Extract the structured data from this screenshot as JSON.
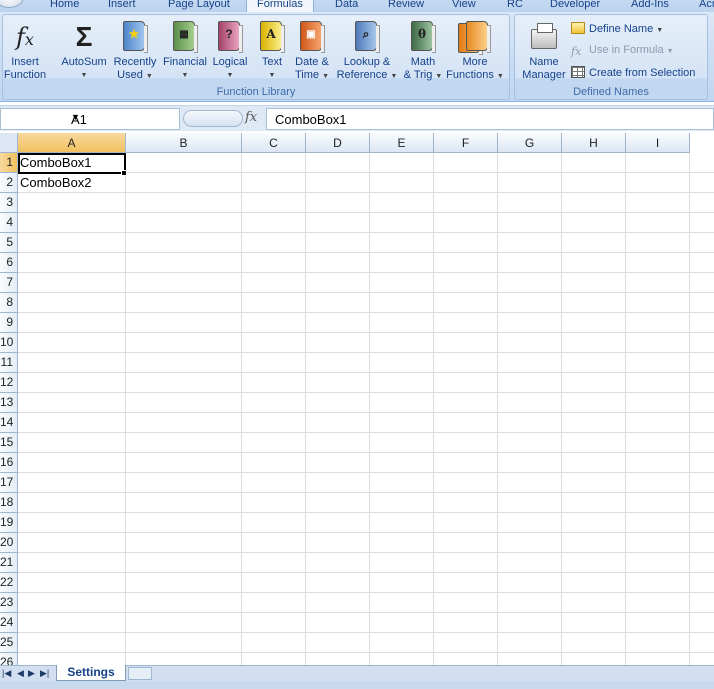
{
  "tabs": [
    "Home",
    "Insert",
    "Page Layout",
    "Formulas",
    "Data",
    "Review",
    "View",
    "RC",
    "Developer",
    "Add-Ins",
    "Acr"
  ],
  "active_tab": "Formulas",
  "function_library": {
    "group_label": "Function Library",
    "insert_function": [
      "Insert",
      "Function"
    ],
    "autosum": "AutoSum",
    "recently_used": [
      "Recently",
      "Used"
    ],
    "financial": "Financial",
    "logical": "Logical",
    "text": "Text",
    "date_time": [
      "Date &",
      "Time"
    ],
    "lookup": [
      "Lookup &",
      "Reference"
    ],
    "math": [
      "Math",
      "& Trig"
    ],
    "more": [
      "More",
      "Functions"
    ]
  },
  "defined_names": {
    "group_label": "Defined Names",
    "name_manager": [
      "Name",
      "Manager"
    ],
    "define_name": "Define Name",
    "use_in_formula": "Use in Formula",
    "create_from_selection": "Create from Selection"
  },
  "formula_bar": {
    "name_box": "A1",
    "fx": "fx",
    "value": "ComboBox1"
  },
  "columns": [
    "A",
    "B",
    "C",
    "D",
    "E",
    "F",
    "G",
    "H",
    "I"
  ],
  "rows": [
    "1",
    "2",
    "3",
    "4",
    "5",
    "6",
    "7",
    "8",
    "9",
    "10",
    "11",
    "12",
    "13",
    "14",
    "15",
    "16",
    "17",
    "18",
    "19",
    "20",
    "21",
    "22",
    "23",
    "24",
    "25",
    "26"
  ],
  "cells": {
    "A1": "ComboBox1",
    "A2": "ComboBox2"
  },
  "sheet_tabs": [
    "Settings"
  ],
  "icon_names": [
    "fx-icon",
    "sigma-icon",
    "star-book-icon",
    "calculator-book-icon",
    "question-book-icon",
    "text-book-icon",
    "calendar-book-icon",
    "magnifier-book-icon",
    "theta-book-icon",
    "stacked-books-icon",
    "name-manager-icon",
    "define-name-icon",
    "use-in-formula-icon",
    "create-from-selection-icon"
  ]
}
